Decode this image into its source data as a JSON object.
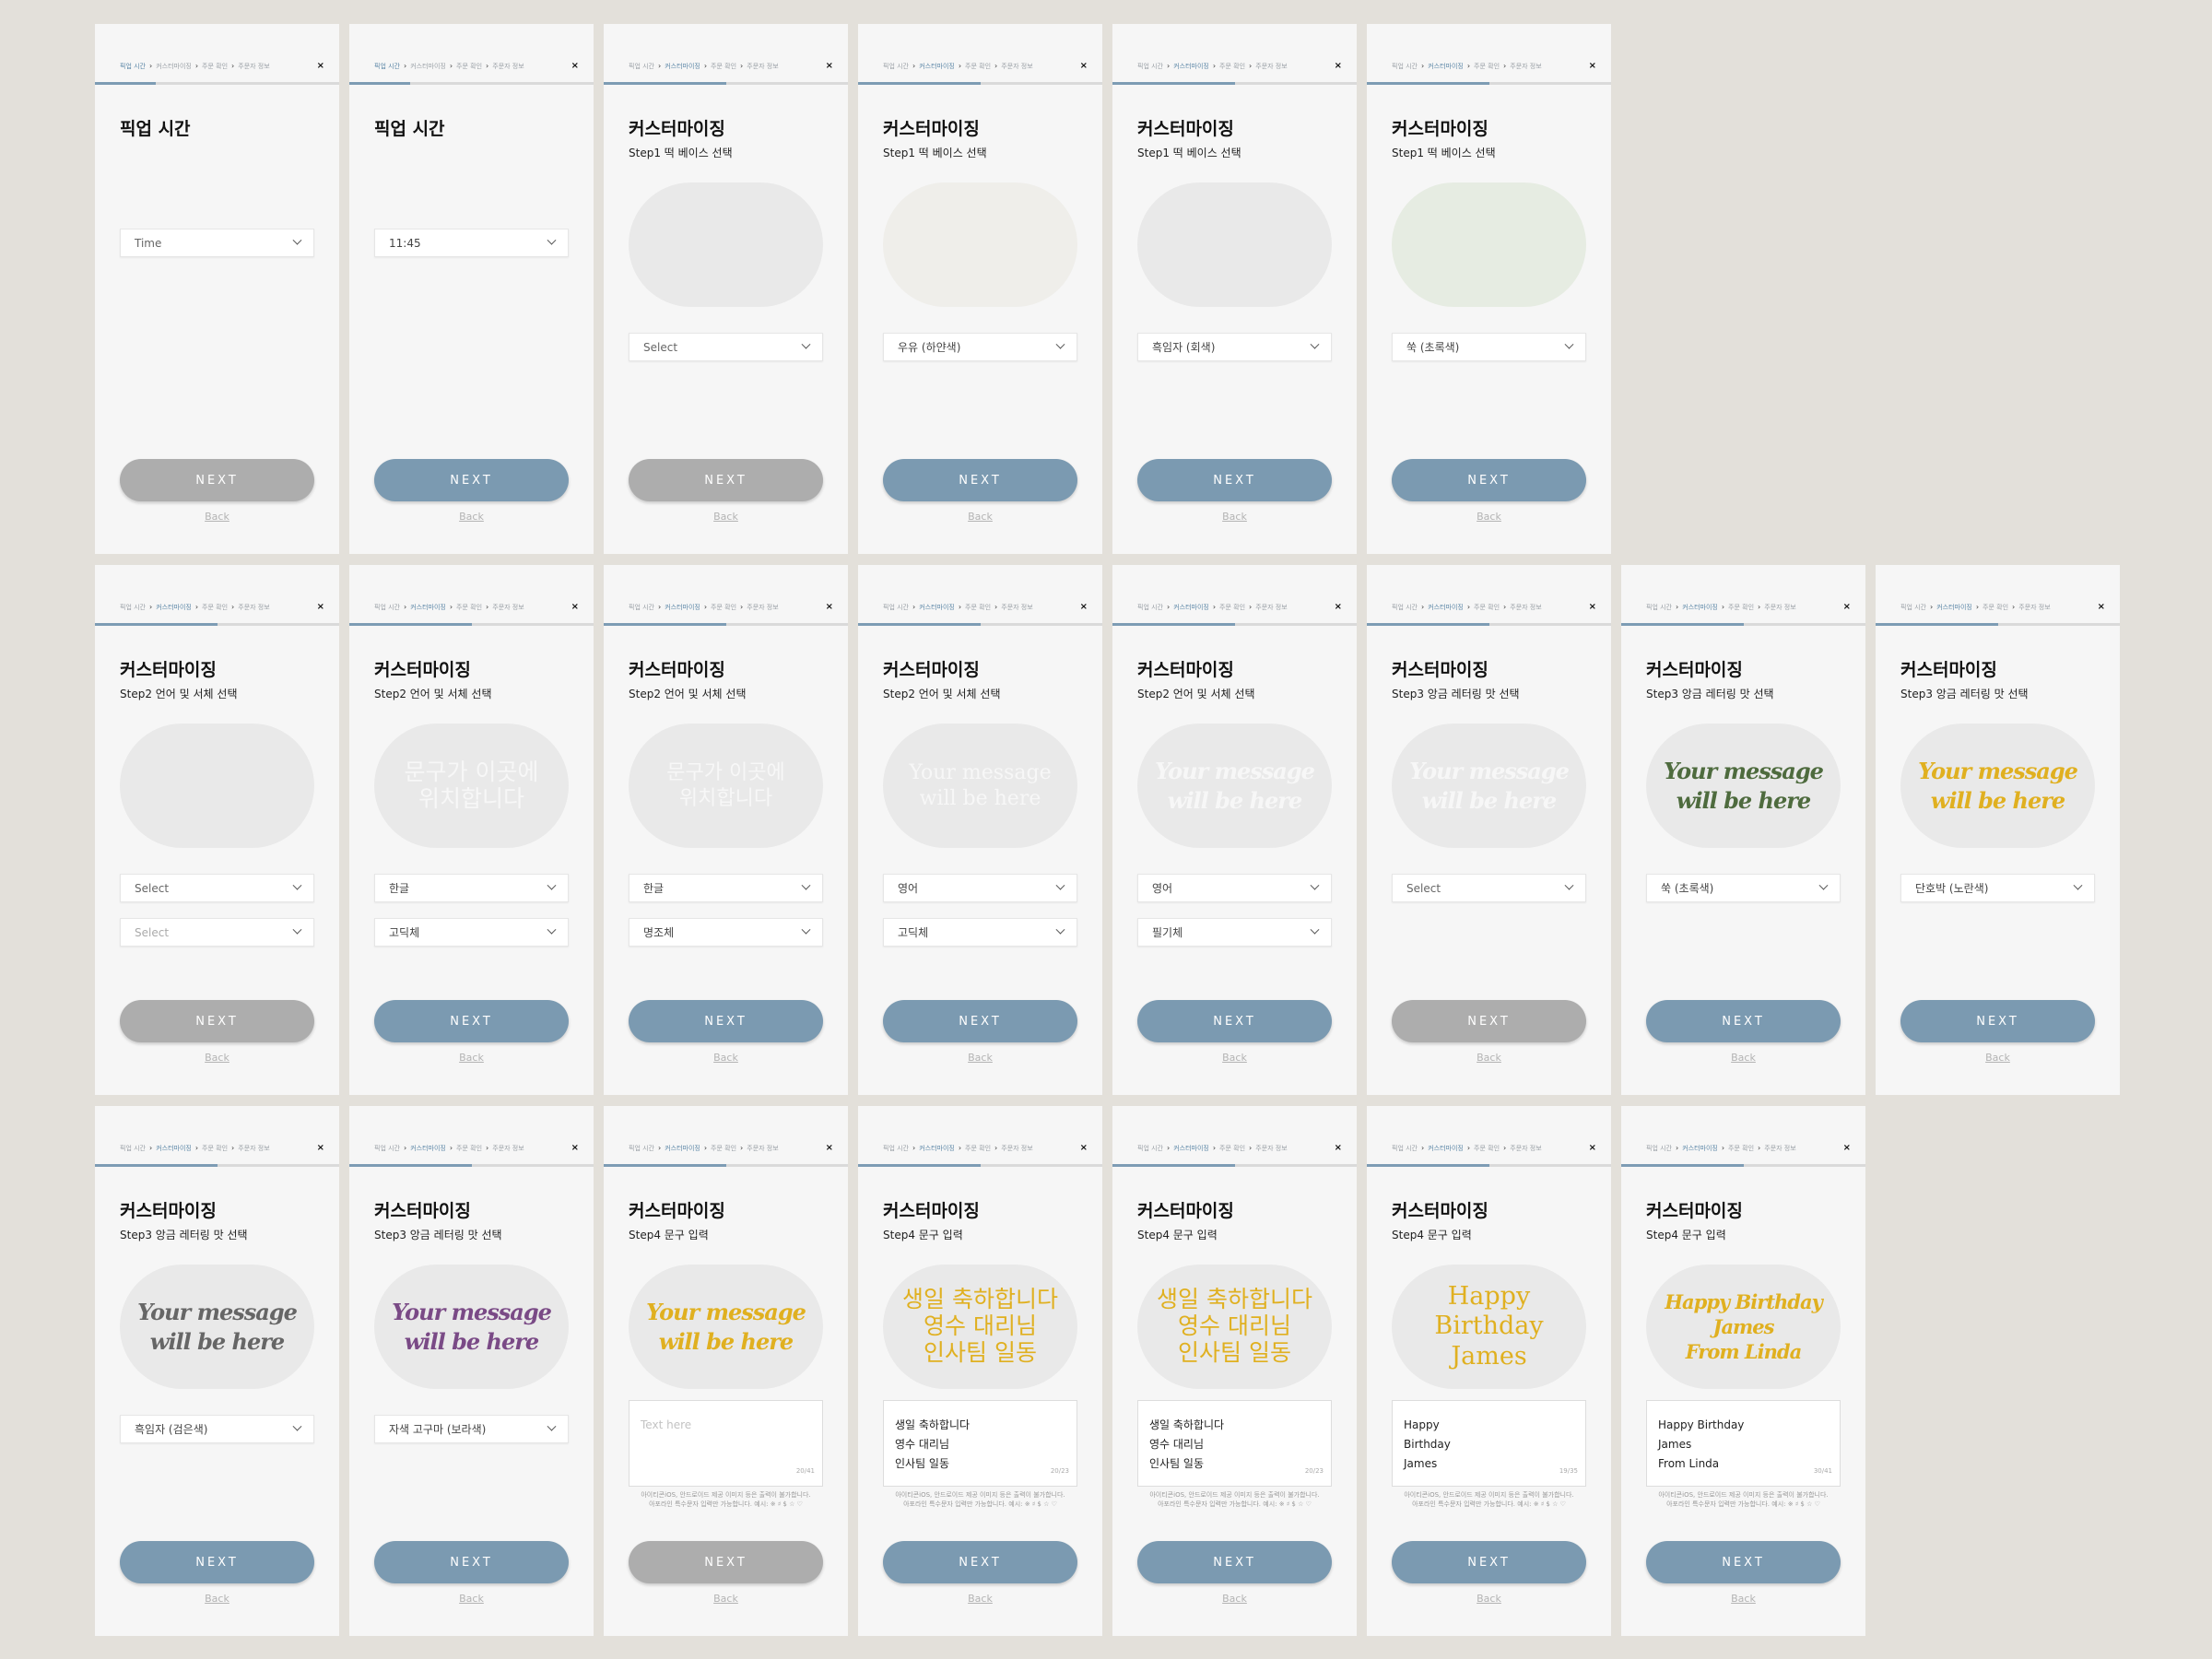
{
  "crumbs": [
    "픽업 시간",
    "커스터마이징",
    "주문 확인",
    "주문자 정보"
  ],
  "close_glyph": "×",
  "next_label": "NEXT",
  "back_label": "Back",
  "title_pickup": "픽업 시간",
  "title_custom": "커스터마이징",
  "step1": "Step1 떡 베이스 선택",
  "step2": "Step2 언어 및 서체 선택",
  "step3": "Step3 앙금 레터링 맛 선택",
  "step4": "Step4 문구 입력",
  "notice": "아이티콘iOS, 안드로이드 제공 이미지 등은 출력이 불가합니다.\n아포라인 특수문자 입력만 가능합니다. 예시: ※ ♯ $ ☆ ♡",
  "preview_ko": "문구가 이곳에\n위치합니다",
  "preview_en": "Your message\nwill be here",
  "colors": {
    "next_active": "#7b9ab1",
    "next_disabled": "#adadad",
    "progress": "#7d9cb4",
    "lettering_green": "#4e6b3e",
    "lettering_yellow": "#e0b020",
    "lettering_gray": "#666666",
    "lettering_purple": "#7a4a86"
  },
  "screens": [
    {
      "title": "픽업 시간",
      "subtitle": "",
      "progress": 0.25,
      "active_crumb": 0,
      "selects": [
        {
          "value": "Time",
          "state": "placeholder"
        }
      ],
      "next_enabled": false
    },
    {
      "title": "픽업 시간",
      "subtitle": "",
      "progress": 0.25,
      "active_crumb": 0,
      "selects": [
        {
          "value": "11:45",
          "state": "filled"
        }
      ],
      "next_enabled": true
    },
    {
      "title": "커스터마이징",
      "subtitle": "Step1 떡 베이스 선택",
      "progress": 0.5,
      "active_crumb": 1,
      "preview": {
        "bg": "#e9e9e9"
      },
      "selects": [
        {
          "value": "Select",
          "state": "placeholder"
        }
      ],
      "next_enabled": false
    },
    {
      "title": "커스터마이징",
      "subtitle": "Step1 떡 베이스 선택",
      "progress": 0.5,
      "active_crumb": 1,
      "preview": {
        "bg": "#efeeea"
      },
      "selects": [
        {
          "value": "우유 (하얀색)",
          "state": "filled"
        }
      ],
      "next_enabled": true
    },
    {
      "title": "커스터마이징",
      "subtitle": "Step1 떡 베이스 선택",
      "progress": 0.5,
      "active_crumb": 1,
      "preview": {
        "bg": "#e9e9e9"
      },
      "selects": [
        {
          "value": "흑임자 (회색)",
          "state": "filled"
        }
      ],
      "next_enabled": true
    },
    {
      "title": "커스터마이징",
      "subtitle": "Step1 떡 베이스 선택",
      "progress": 0.5,
      "active_crumb": 1,
      "preview": {
        "bg": "#e6ece2"
      },
      "selects": [
        {
          "value": "쑥 (초록색)",
          "state": "filled"
        }
      ],
      "next_enabled": true
    },
    {
      "title": "커스터마이징",
      "subtitle": "Step2 언어 및 서체 선택",
      "progress": 0.5,
      "active_crumb": 1,
      "preview": {
        "bg": "#e9e9e9"
      },
      "selects": [
        {
          "value": "Select",
          "state": "placeholder"
        },
        {
          "value": "Select",
          "state": "dim"
        }
      ],
      "next_enabled": false
    },
    {
      "title": "커스터마이징",
      "subtitle": "Step2 언어 및 서체 선택",
      "progress": 0.5,
      "active_crumb": 1,
      "preview": {
        "bg": "#e9e9e9",
        "text": "문구가 이곳에\n위치합니다",
        "font": "gothic",
        "color": "#f7f7f7"
      },
      "selects": [
        {
          "value": "한글",
          "state": "filled"
        },
        {
          "value": "고딕체",
          "state": "filled"
        }
      ],
      "next_enabled": true
    },
    {
      "title": "커스터마이징",
      "subtitle": "Step2 언어 및 서체 선택",
      "progress": 0.5,
      "active_crumb": 1,
      "preview": {
        "bg": "#e9e9e9",
        "text": "문구가 이곳에\n위치합니다",
        "font": "serif",
        "color": "#f7f7f7"
      },
      "selects": [
        {
          "value": "한글",
          "state": "filled"
        },
        {
          "value": "명조체",
          "state": "filled"
        }
      ],
      "next_enabled": true
    },
    {
      "title": "커스터마이징",
      "subtitle": "Step2 언어 및 서체 선택",
      "progress": 0.5,
      "active_crumb": 1,
      "preview": {
        "bg": "#e9e9e9",
        "text": "Your message\nwill be here",
        "font": "serif",
        "color": "#f7f7f7"
      },
      "selects": [
        {
          "value": "영어",
          "state": "filled"
        },
        {
          "value": "고딕체",
          "state": "filled"
        }
      ],
      "next_enabled": true
    },
    {
      "title": "커스터마이징",
      "subtitle": "Step2 언어 및 서체 선택",
      "progress": 0.5,
      "active_crumb": 1,
      "preview": {
        "bg": "#e9e9e9",
        "text": "Your message\nwill be here",
        "font": "script",
        "color": "#f7f7f7"
      },
      "selects": [
        {
          "value": "영어",
          "state": "filled"
        },
        {
          "value": "필기체",
          "state": "filled"
        }
      ],
      "next_enabled": true
    },
    {
      "title": "커스터마이징",
      "subtitle": "Step3 앙금 레터링 맛 선택",
      "progress": 0.5,
      "active_crumb": 1,
      "preview": {
        "bg": "#e9e9e9",
        "text": "Your message\nwill be here",
        "font": "script",
        "color": "#f7f7f7"
      },
      "selects": [
        {
          "value": "Select",
          "state": "placeholder"
        }
      ],
      "next_enabled": false
    },
    {
      "title": "커스터마이징",
      "subtitle": "Step3 앙금 레터링 맛 선택",
      "progress": 0.5,
      "active_crumb": 1,
      "preview": {
        "bg": "#e9e9e9",
        "text": "Your message\nwill be here",
        "font": "script",
        "color": "#4e6b3e"
      },
      "selects": [
        {
          "value": "쑥 (초록색)",
          "state": "filled"
        }
      ],
      "next_enabled": true
    },
    {
      "title": "커스터마이징",
      "subtitle": "Step3 앙금 레터링 맛 선택",
      "progress": 0.5,
      "active_crumb": 1,
      "preview": {
        "bg": "#e9e9e9",
        "text": "Your message\nwill be here",
        "font": "script",
        "color": "#e0b020"
      },
      "selects": [
        {
          "value": "단호박 (노란색)",
          "state": "filled"
        }
      ],
      "next_enabled": true
    },
    {
      "title": "커스터마이징",
      "subtitle": "Step3 앙금 레터링 맛 선택",
      "progress": 0.5,
      "active_crumb": 1,
      "preview": {
        "bg": "#e9e9e9",
        "text": "Your message\nwill be here",
        "font": "script",
        "color": "#666666"
      },
      "selects": [
        {
          "value": "흑임자 (검은색)",
          "state": "filled"
        }
      ],
      "next_enabled": true
    },
    {
      "title": "커스터마이징",
      "subtitle": "Step3 앙금 레터링 맛 선택",
      "progress": 0.5,
      "active_crumb": 1,
      "preview": {
        "bg": "#e9e9e9",
        "text": "Your message\nwill be here",
        "font": "script",
        "color": "#7a4a86"
      },
      "selects": [
        {
          "value": "자색 고구마 (보라색)",
          "state": "filled"
        }
      ],
      "next_enabled": true
    },
    {
      "title": "커스터마이징",
      "subtitle": "Step4 문구 입력",
      "progress": 0.5,
      "active_crumb": 1,
      "preview": {
        "bg": "#e9e9e9",
        "text": "Your message\nwill be here",
        "font": "script",
        "color": "#e0b020"
      },
      "textarea": {
        "value": "Text here",
        "placeholder": true,
        "counter": "20/41"
      },
      "next_enabled": false
    },
    {
      "title": "커스터마이징",
      "subtitle": "Step4 문구 입력",
      "progress": 0.5,
      "active_crumb": 1,
      "preview": {
        "bg": "#e9e9e9",
        "text": "생일 축하합니다\n영수 대리님\n인사팀 일동",
        "font": "gothic",
        "color": "#e0b020"
      },
      "textarea": {
        "value": "생일 축하합니다\n영수 대리님\n인사팀 일동",
        "placeholder": false,
        "counter": "20/23"
      },
      "next_enabled": true
    },
    {
      "title": "커스터마이징",
      "subtitle": "Step4 문구 입력",
      "progress": 0.5,
      "active_crumb": 1,
      "preview": {
        "bg": "#e9e9e9",
        "text": "생일 축하합니다\n영수 대리님\n인사팀 일동",
        "font": "serif-ko",
        "color": "#e0b020"
      },
      "textarea": {
        "value": "생일 축하합니다\n영수 대리님\n인사팀 일동",
        "placeholder": false,
        "counter": "20/23"
      },
      "next_enabled": true
    },
    {
      "title": "커스터마이징",
      "subtitle": "Step4 문구 입력",
      "progress": 0.5,
      "active_crumb": 1,
      "preview": {
        "bg": "#e9e9e9",
        "text": "Happy\nBirthday\nJames",
        "font": "serif-l",
        "color": "#e0b020"
      },
      "textarea": {
        "value": "Happy\nBirthday\nJames",
        "placeholder": false,
        "counter": "19/35"
      },
      "next_enabled": true
    },
    {
      "title": "커스터마이징",
      "subtitle": "Step4 문구 입력",
      "progress": 0.5,
      "active_crumb": 1,
      "preview": {
        "bg": "#e9e9e9",
        "text": "Happy Birthday\nJames\nFrom Linda",
        "font": "script-s",
        "color": "#e0b020"
      },
      "textarea": {
        "value": "Happy Birthday\nJames\nFrom Linda",
        "placeholder": false,
        "counter": "30/41"
      },
      "next_enabled": true
    }
  ]
}
